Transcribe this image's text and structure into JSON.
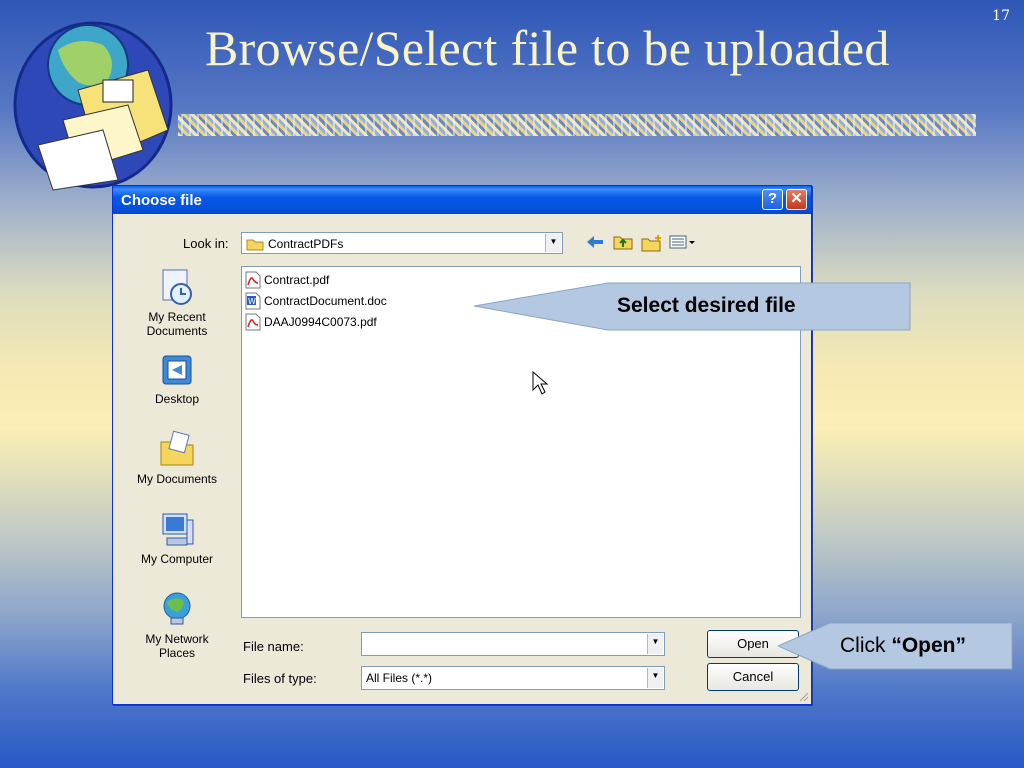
{
  "slide": {
    "number": "17",
    "title": "Browse/Select file to be uploaded"
  },
  "dialog": {
    "title": "Choose file",
    "look_in_label": "Look in:",
    "look_in_value": "ContractPDFs",
    "places": [
      "My Recent Documents",
      "Desktop",
      "My Documents",
      "My Computer",
      "My Network Places"
    ],
    "files": [
      {
        "name": "Contract.pdf",
        "icon": "pdf-file-icon"
      },
      {
        "name": "ContractDocument.doc",
        "icon": "word-file-icon"
      },
      {
        "name": "DAAJ0994C0073.pdf",
        "icon": "pdf-file-icon"
      }
    ],
    "file_name_label": "File name:",
    "file_name_value": "",
    "files_of_type_label": "Files of type:",
    "files_of_type_value": "All Files (*.*)",
    "open_label": "Open",
    "cancel_label": "Cancel",
    "help_label": "?",
    "close_label": "✕"
  },
  "callouts": {
    "select_text": "Select desired file",
    "click_prefix": "Click ",
    "click_emphasis": "“Open”"
  },
  "colors": {
    "titlebar": "#0451db",
    "dialog_bg": "#ece9d8",
    "callout_fill": "#b4c8e1",
    "slide_title": "#fbf3c8"
  }
}
